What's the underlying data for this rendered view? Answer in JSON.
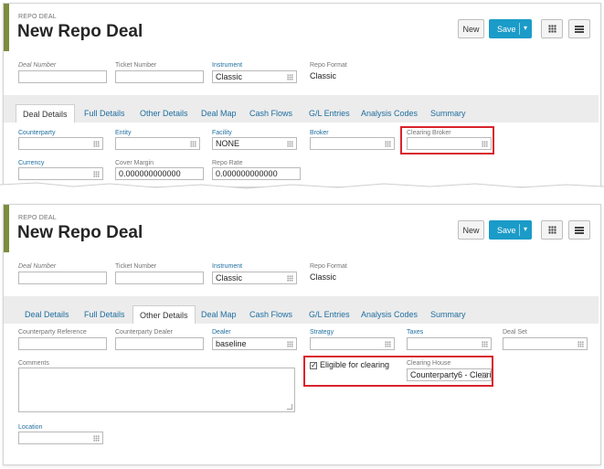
{
  "header": {
    "breadcrumb": "REPO DEAL",
    "title": "New Repo Deal",
    "new_label": "New",
    "save_label": "Save"
  },
  "deal_fields": {
    "deal_number_label": "Deal Number",
    "ticket_number_label": "Ticket Number",
    "instrument_label": "Instrument",
    "instrument_value": "Classic",
    "repo_format_label": "Repo Format",
    "repo_format_value": "Classic"
  },
  "tabs": [
    "Deal Details",
    "Full Details",
    "Other Details",
    "Deal Map",
    "Cash Flows",
    "G/L Entries",
    "Analysis Codes",
    "Summary"
  ],
  "deal_details": {
    "counterparty_label": "Counterparty",
    "entity_label": "Entity",
    "facility_label": "Facility",
    "facility_value": "NONE",
    "broker_label": "Broker",
    "clearing_broker_label": "Clearing Broker",
    "currency_label": "Currency",
    "cover_margin_label": "Cover Margin",
    "cover_margin_value": "0.000000000000",
    "repo_rate_label": "Repo Rate",
    "repo_rate_value": "0.000000000000"
  },
  "other_details": {
    "counterparty_reference_label": "Counterparty Reference",
    "counterparty_dealer_label": "Counterparty Dealer",
    "dealer_label": "Dealer",
    "dealer_value": "baseline",
    "strategy_label": "Strategy",
    "taxes_label": "Taxes",
    "deal_set_label": "Deal Set",
    "comments_label": "Comments",
    "eligible_label": "Eligible for clearing",
    "eligible_checked": true,
    "clearing_house_label": "Clearing House",
    "clearing_house_value": "Counterparty6 - Cleari",
    "location_label": "Location"
  },
  "colors": {
    "accent": "#7b8d3c",
    "save_button": "#1b9bc8",
    "highlight": "#d8242c",
    "label_blue": "#1f6ea0"
  }
}
